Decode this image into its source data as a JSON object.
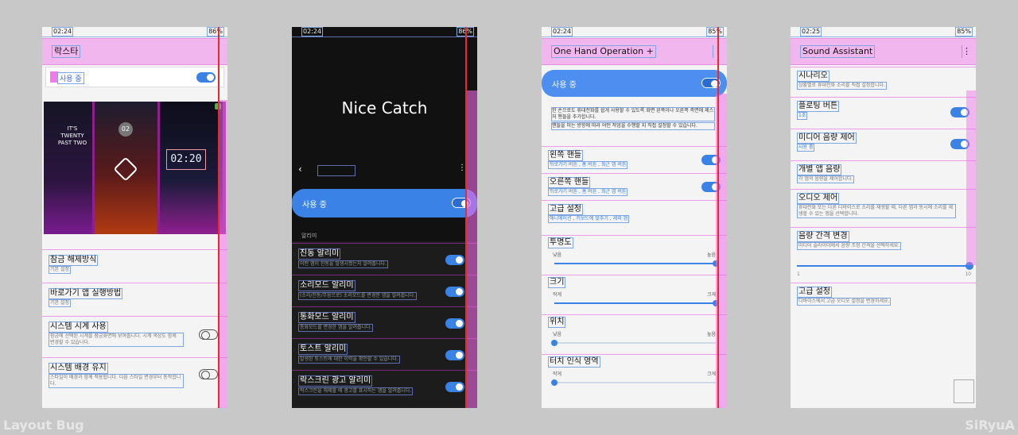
{
  "phone1": {
    "status_time": "02:24",
    "status_right": "86%",
    "title": "락스타",
    "switch_label": "사용 중",
    "clock_texts": [
      "IT'S TWENTY PAST TWO",
      "02",
      "02:20"
    ],
    "items": [
      {
        "title": "잠금 해제방식",
        "sub": "기본 설정"
      },
      {
        "title": "바로가기 앱 실행방법",
        "sub": "기본 설정"
      },
      {
        "title": "시스템 시계 사용",
        "sub": "잠금에 선택된 시계를 잠금화면에 보여줍니다. 시계 색상도 함께 변경할 수 있습니다."
      },
      {
        "title": "시스템 배경 유지",
        "sub": "스타일이 배경과 함께 적용됩니다. 다음 스타일 변경부터 동작합니다."
      }
    ]
  },
  "phone2": {
    "status_time": "02:24",
    "status_right": "86%",
    "title": "Nice Catch",
    "switch_label": "사용 중",
    "section": "알리미",
    "items": [
      {
        "title": "진동 알리미",
        "sub": "어떤 앱이 진동을 발생시켰는지 알려줍니다."
      },
      {
        "title": "소리모드 알리미",
        "sub": "(소리/진동/무음으로) 소리모드를 변경한 앱을 알려줍니다."
      },
      {
        "title": "통화모드 알리미",
        "sub": "통화모드를 변경한 앱을 알려줍니다."
      },
      {
        "title": "토스트 알리미",
        "sub": "발생된 토스트에 대한 이력을 확인할 수 있습니다."
      },
      {
        "title": "락스크린 광고 알리미",
        "sub": "락스크린을 해제할 때 광고를 표시하는 앱을 알려줍니다."
      }
    ]
  },
  "phone3": {
    "status_time": "02:24",
    "status_right": "85%",
    "title": "One Hand Operation +",
    "switch_label": "사용 중",
    "desc1": "한 손으로도 휴대전화를 쉽게 사용할 수 있도록 화면 왼쪽이나 오른쪽 측면에 제스처 핸들을 추가합니다.",
    "desc2": "핸들을 미는 방향에 따라 어떤 작업을 수행할 지 직접 설정할 수 있습니다.",
    "items": [
      {
        "title": "왼쪽 핸들",
        "sub": "뒤로가기 버튼 , 홈 버튼 , 최근 앱 버튼"
      },
      {
        "title": "오른쪽 핸들",
        "sub": "뒤로가기 버튼 , 홈 버튼 , 최근 앱 버튼"
      },
      {
        "title": "고급 설정",
        "sub": "애니메이션 , 키보드에 맞추기 , 제외 앱"
      }
    ],
    "sliders": [
      {
        "title": "투명도",
        "left": "낮음",
        "right": "높음",
        "value": 1.0
      },
      {
        "title": "크기",
        "left": "작게",
        "right": "크게",
        "value": 1.0
      },
      {
        "title": "위치",
        "left": "낮음",
        "right": "높음",
        "value": 0.0
      },
      {
        "title": "터치 인식 영역",
        "left": "작게",
        "right": "크게",
        "value": 0.0
      }
    ]
  },
  "phone4": {
    "status_time": "02:25",
    "status_right": "85%",
    "title": "Sound Assistant",
    "items": [
      {
        "title": "시나리오",
        "sub": "상황별로 휴대전화 소리를 직접 설정합니다."
      },
      {
        "title": "플로팅 버튼",
        "sub": "1초"
      },
      {
        "title": "미디어 음량 제어",
        "sub": "사용 중"
      },
      {
        "title": "개별 앱 음량",
        "sub": "각 앱의 음량을 제어합니다."
      },
      {
        "title": "오디오 제어",
        "sub": "휴대전화 또는 다른 디바이스로 소리를 재생할 때, 다른 앱과 동시에 소리를 재생할 수 있는 앱을 선택합니다."
      },
      {
        "title": "음량 간격 변경",
        "sub": "미디어 슬라이더에서 음량 조정 간격을 선택하세요."
      },
      {
        "title": "고급 설정",
        "sub": "디바이스에서 고급 오디오 설정을 변경하세요."
      }
    ],
    "slider_min": "1",
    "slider_max": "10",
    "slider_value": 10
  },
  "watermark_left": "Layout Bug",
  "watermark_right": "SiRyuA"
}
